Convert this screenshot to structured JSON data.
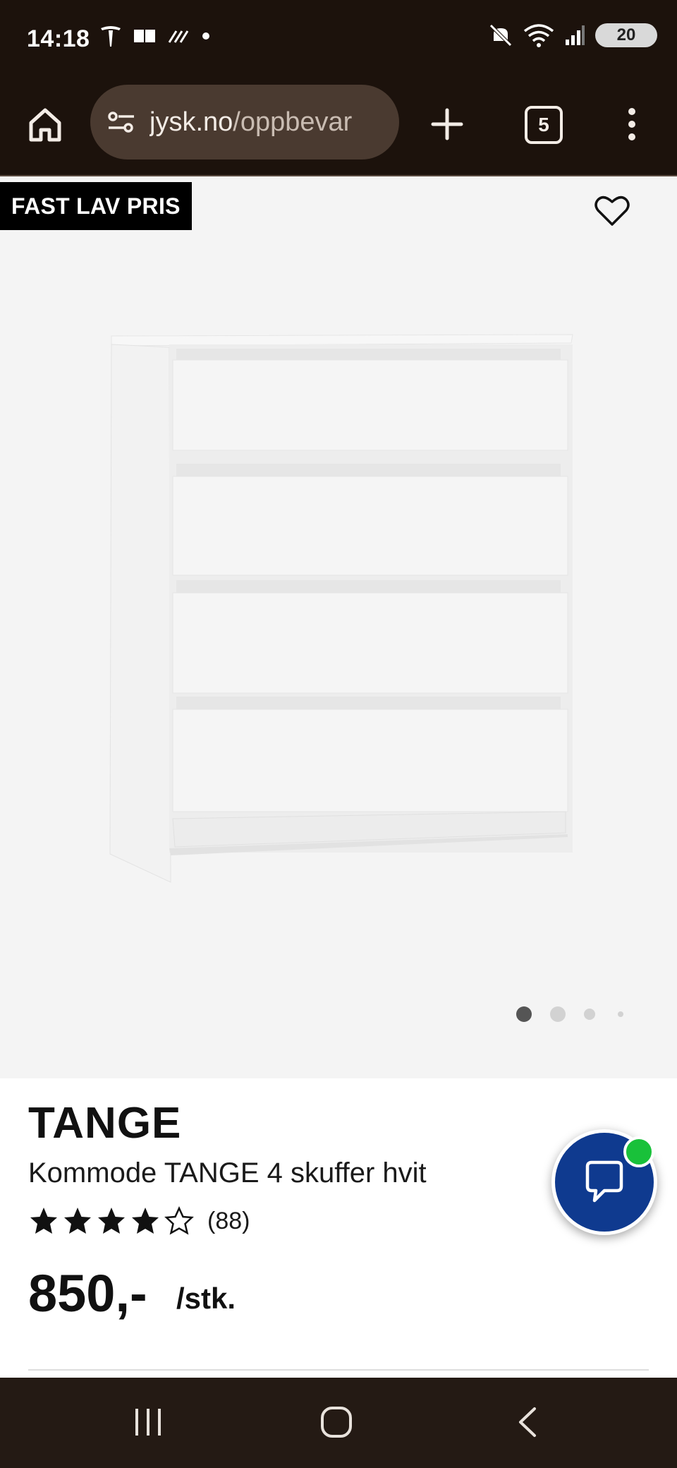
{
  "status_bar": {
    "time": "14:18",
    "battery": "20",
    "icons_left": [
      "tesla-icon",
      "message-icon",
      "signal-strikes-icon",
      "notification-dot-icon"
    ],
    "icons_right": [
      "mute-icon",
      "wifi-icon",
      "cell-signal-icon",
      "battery-icon"
    ]
  },
  "browser": {
    "url_domain": "jysk.no",
    "url_path": "/oppbevar",
    "tab_count": "5",
    "icons": [
      "home-icon",
      "site-settings-icon",
      "new-tab-icon",
      "tab-switcher-icon",
      "more-vert-icon"
    ]
  },
  "product": {
    "badge": "FAST LAV PRIS",
    "brand": "TANGE",
    "title": "Kommode TANGE 4 skuffer hvit",
    "rating": 4,
    "rating_max": 5,
    "reviews": "(88)",
    "price": "850,-",
    "unit": "/stk.",
    "gallery_images": 4,
    "gallery_active_index": 0
  },
  "colors": {
    "chrome_dark": "#1c120c",
    "chat_button": "#0f3a8f",
    "online_dot": "#19c13a"
  },
  "nav": {
    "icons": [
      "recents-icon",
      "home-circle-icon",
      "back-icon"
    ]
  }
}
